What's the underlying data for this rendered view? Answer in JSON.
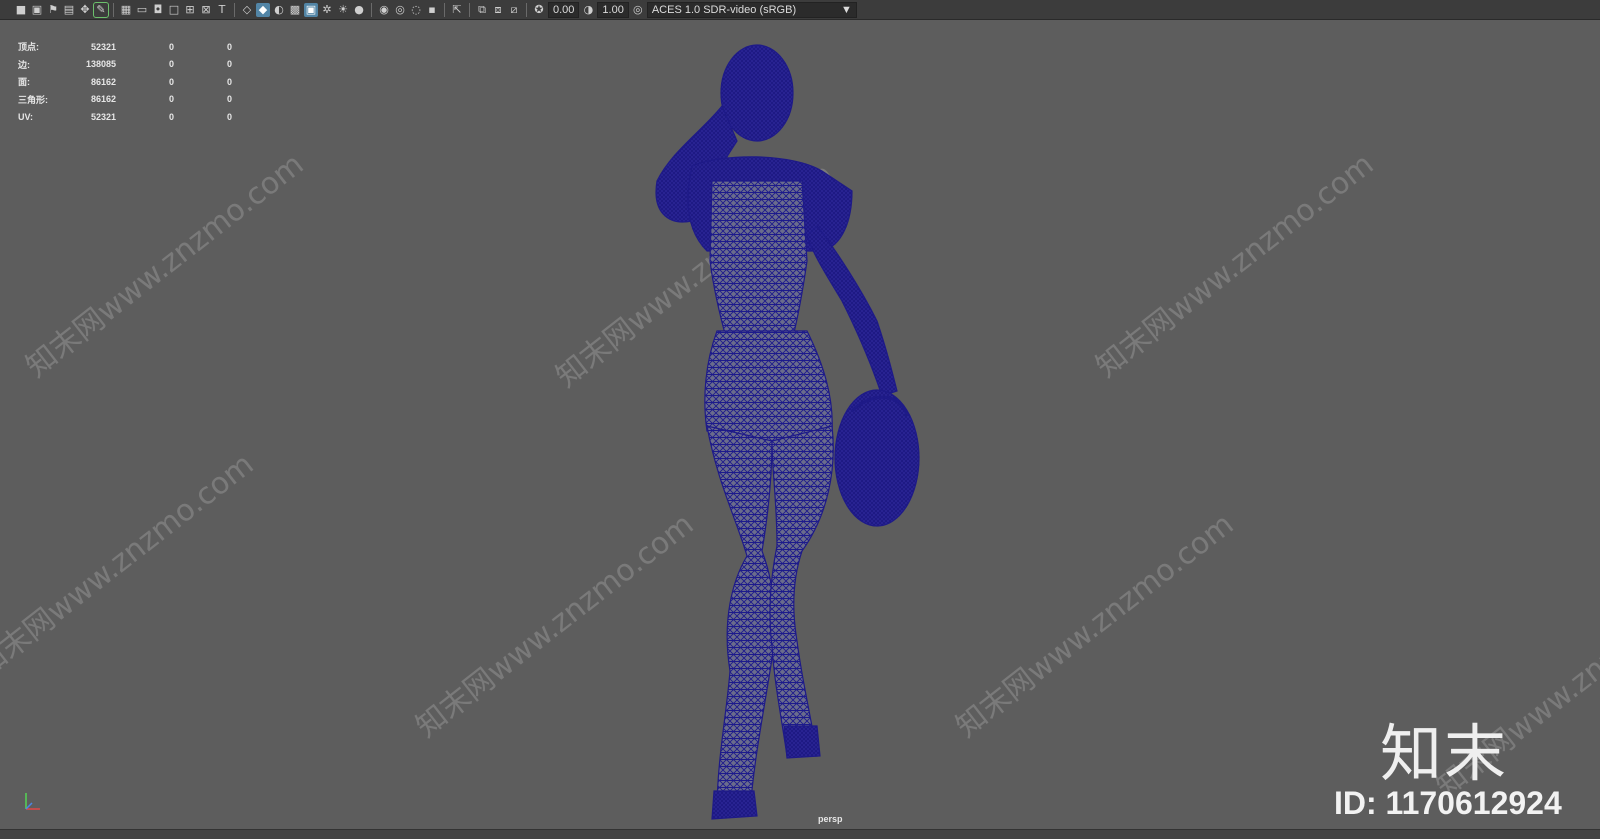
{
  "toolbar": {
    "exposure_value": "0.00",
    "gamma_value": "1.00",
    "color_space": "ACES 1.0 SDR-video (sRGB)",
    "icons": [
      "camera-icon",
      "camera-attrs-icon",
      "bookmark-icon",
      "image-plane-icon",
      "2d-pan-icon",
      "grease-pencil-icon",
      "grid-icon",
      "film-gate-icon",
      "resolution-gate-icon",
      "gate-mask-icon",
      "field-chart-icon",
      "safe-action-icon",
      "safe-title-icon",
      "wireframe-icon",
      "smooth-shade-icon",
      "default-material-icon",
      "xray-icon",
      "isolate-icon",
      "lights-icon",
      "shadows-icon",
      "ambient-occlusion-icon",
      "motion-blur-icon",
      "anti-alias-icon",
      "depth-of-field-icon",
      "select-icon",
      "camera-guide-icon",
      "parallel-icon",
      "exposure-icon",
      "gamma-icon",
      "color-management-icon"
    ]
  },
  "hud": {
    "rows": [
      {
        "label": "顶点:",
        "v1": "52321",
        "v2": "0",
        "v3": "0"
      },
      {
        "label": "边:",
        "v1": "138085",
        "v2": "0",
        "v3": "0"
      },
      {
        "label": "面:",
        "v1": "86162",
        "v2": "0",
        "v3": "0"
      },
      {
        "label": "三角形:",
        "v1": "86162",
        "v2": "0",
        "v3": "0"
      },
      {
        "label": "UV:",
        "v1": "52321",
        "v2": "0",
        "v3": "0"
      }
    ]
  },
  "viewport": {
    "camera": "persp",
    "wireframe_color": "#2a1f8f"
  },
  "watermark": {
    "text": "知末网www.znzmo.com",
    "brand": "知末",
    "id_text": "ID: 1170612924"
  }
}
